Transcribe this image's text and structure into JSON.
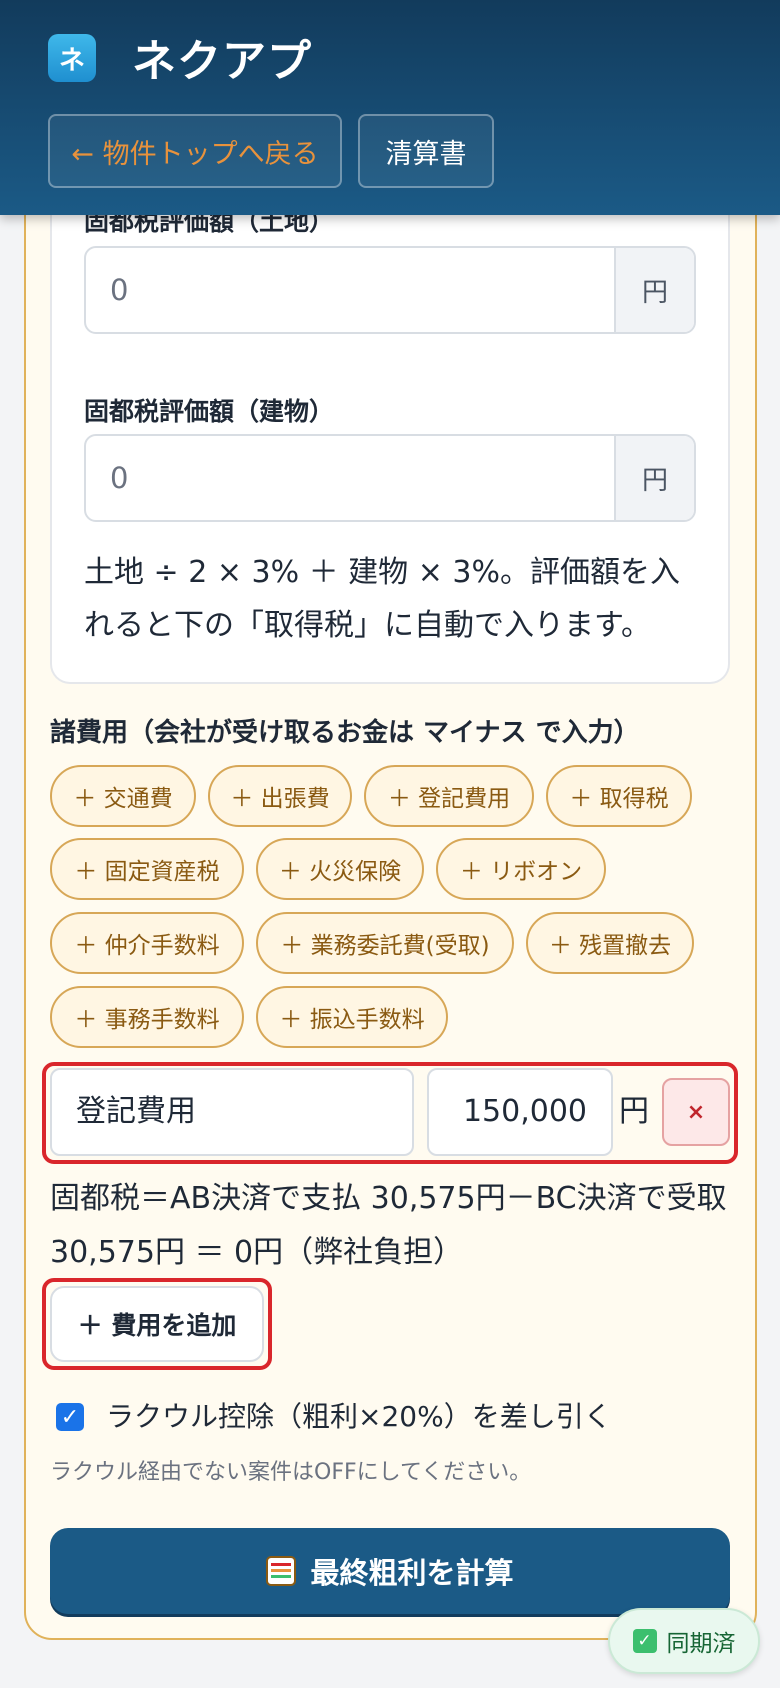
{
  "app": {
    "logo_char": "ネ",
    "title": "ネクアプ"
  },
  "header": {
    "back_label": "← 物件トップへ戻る",
    "doc_label": "清算書"
  },
  "tax_eval": {
    "land_label": "固都税評価額（土地）",
    "land_value": "0",
    "land_unit": "円",
    "building_label": "固都税評価額（建物）",
    "building_value": "0",
    "building_unit": "円",
    "note": "土地 ÷ 2 × 3% ＋ 建物 × 3%。評価額を入れると下の「取得税」に自動で入ります。"
  },
  "expenses": {
    "title": "諸費用（会社が受け取るお金は マイナス で入力）",
    "chips": [
      "＋ 交通費",
      "＋ 出張費",
      "＋ 登記費用",
      "＋ 取得税",
      "＋ 固定資産税",
      "＋ 火災保険",
      "＋ リボオン",
      "＋ 仲介手数料",
      "＋ 業務委託費(受取)",
      "＋ 残置撤去",
      "＋ 事務手数料",
      "＋ 振込手数料"
    ],
    "rows": [
      {
        "name": "登記費用",
        "amount": "150,000",
        "unit": "円",
        "delete": "×"
      }
    ],
    "calc_note": "固都税＝AB決済で支払 30,575円－BC決済で受取 30,575円 ＝ 0円（弊社負担）",
    "add_label": "＋ 費用を追加"
  },
  "rakuuru": {
    "checked": true,
    "check_mark": "✓",
    "label": "ラクウル控除（粗利×20%）を差し引く",
    "hint": "ラクウル経由でない案件はOFFにしてください。"
  },
  "calc_button": {
    "icon": "abacus-icon",
    "label": "最終粗利を計算"
  },
  "sync": {
    "icon_mark": "✓",
    "label": "同期済"
  },
  "colors": {
    "brand": "#1b5a86",
    "accent": "#e8923c",
    "highlight": "#d9262b",
    "chip_border": "#d7a757"
  }
}
